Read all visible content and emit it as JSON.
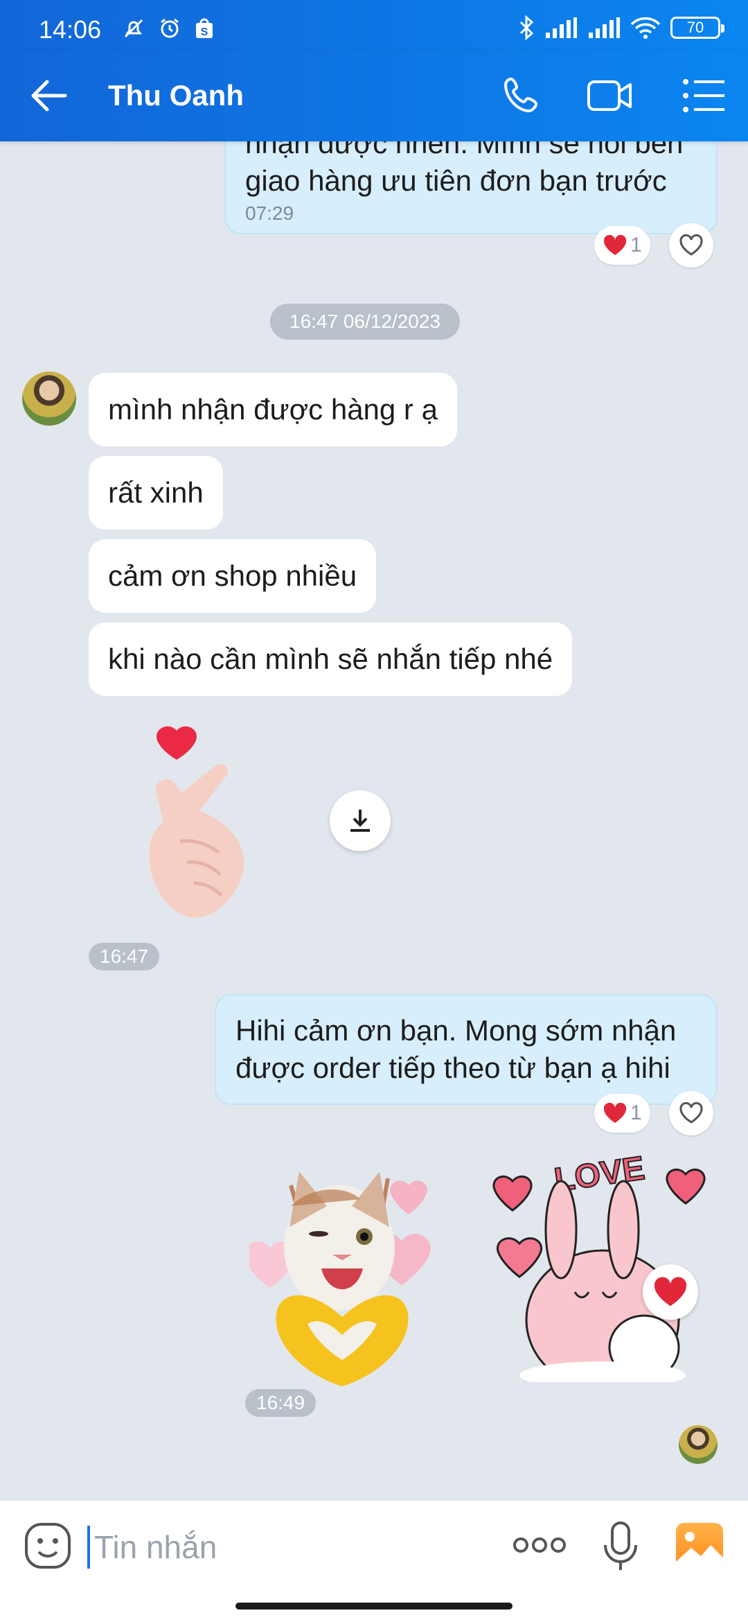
{
  "status_bar": {
    "time": "14:06",
    "battery": "70",
    "left_icons": [
      "mute-icon",
      "alarm-icon",
      "shopee-icon"
    ],
    "right_icons": [
      "bluetooth-icon",
      "signal-icon",
      "signal-icon",
      "wifi-icon",
      "battery-icon"
    ]
  },
  "header": {
    "title": "Thu Oanh",
    "buttons": [
      "back-arrow-icon",
      "phone-icon",
      "video-call-icon",
      "menu-list-icon"
    ],
    "color": "#0a85f0"
  },
  "messages": {
    "partial_out": {
      "line1": "nhận được nhen. Mình sẽ nói bên",
      "line2": "giao hàng ưu tiên đơn bạn trước",
      "time": "07:29",
      "reaction_count": "1"
    },
    "date_separator": "16:47 06/12/2023",
    "incoming": [
      "mình nhận được hàng r ạ",
      "rất xinh",
      "cảm ơn shop nhiều",
      "khi nào cần mình sẽ nhắn tiếp nhé"
    ],
    "sticker_time_in": "16:47",
    "outgoing": {
      "line1": "Hihi cảm ơn bạn. Mong sớm nhận",
      "line2": "được order tiếp theo từ bạn ạ hihi",
      "reaction_count": "1"
    },
    "sticker_time_out": "16:49",
    "stickers": [
      "finger-heart-sticker",
      "cat-heart-hands-sticker",
      "love-bunny-sticker"
    ]
  },
  "input_bar": {
    "placeholder": "Tin nhắn"
  }
}
